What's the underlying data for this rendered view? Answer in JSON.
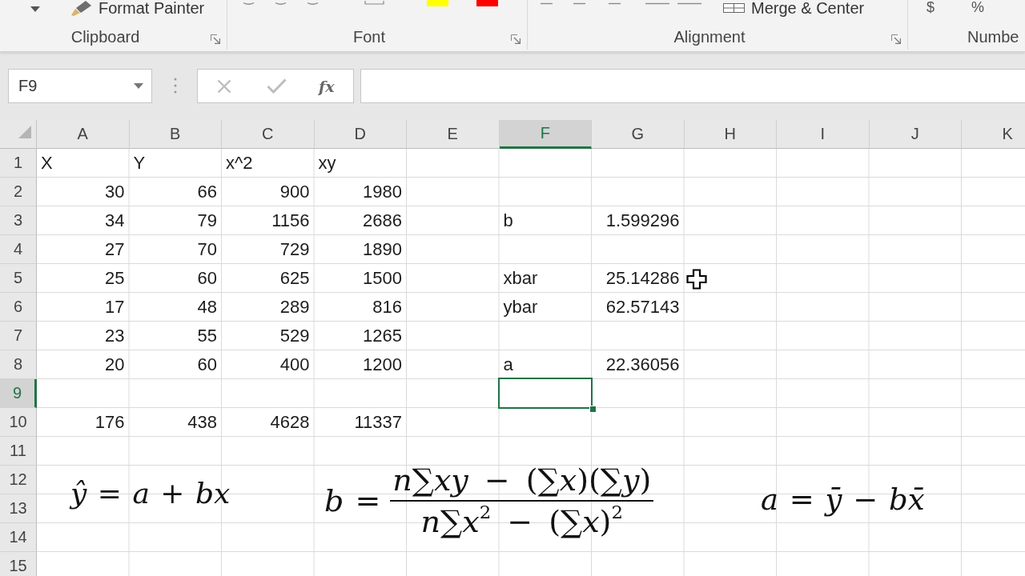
{
  "ribbon": {
    "groups": [
      {
        "kind": "clipboard",
        "label": "Clipboard",
        "launcher": true,
        "command": "Format Painter"
      },
      {
        "kind": "font",
        "label": "Font",
        "launcher": true,
        "swatches": [
          {
            "color": "#ffff00"
          },
          {
            "color": "#ff0000"
          }
        ]
      },
      {
        "kind": "alignment",
        "label": "Alignment",
        "launcher": true,
        "command": "Merge & Center"
      },
      {
        "kind": "number",
        "label": "Numbe",
        "symbols": [
          "$",
          "%"
        ]
      }
    ]
  },
  "formula_bar": {
    "name_box": "F9",
    "function_button": "fx"
  },
  "columns": [
    {
      "label": "A",
      "selected": false
    },
    {
      "label": "B",
      "selected": false
    },
    {
      "label": "C",
      "selected": false
    },
    {
      "label": "D",
      "selected": false
    },
    {
      "label": "E",
      "selected": false
    },
    {
      "label": "F",
      "selected": true
    },
    {
      "label": "G",
      "selected": false
    },
    {
      "label": "H",
      "selected": false
    },
    {
      "label": "I",
      "selected": false
    },
    {
      "label": "J",
      "selected": false
    },
    {
      "label": "K",
      "selected": false
    }
  ],
  "rows": [
    {
      "label": "1",
      "selected": false,
      "cells": [
        {
          "kind": "text",
          "value": "X"
        },
        {
          "kind": "text",
          "value": "Y"
        },
        {
          "kind": "text",
          "value": "x^2"
        },
        {
          "kind": "text",
          "value": "xy"
        }
      ]
    },
    {
      "label": "2",
      "selected": false,
      "cells": [
        {
          "kind": "number",
          "value": "30"
        },
        {
          "kind": "number",
          "value": "66"
        },
        {
          "kind": "number",
          "value": "900"
        },
        {
          "kind": "number",
          "value": "1980"
        }
      ]
    },
    {
      "label": "3",
      "selected": false,
      "cells": [
        {
          "kind": "number",
          "value": "34"
        },
        {
          "kind": "number",
          "value": "79"
        },
        {
          "kind": "number",
          "value": "1156"
        },
        {
          "kind": "number",
          "value": "2686"
        },
        null,
        {
          "kind": "text",
          "value": "b"
        },
        {
          "kind": "number",
          "value": "1.599296"
        }
      ]
    },
    {
      "label": "4",
      "selected": false,
      "cells": [
        {
          "kind": "number",
          "value": "27"
        },
        {
          "kind": "number",
          "value": "70"
        },
        {
          "kind": "number",
          "value": "729"
        },
        {
          "kind": "number",
          "value": "1890"
        }
      ]
    },
    {
      "label": "5",
      "selected": false,
      "cells": [
        {
          "kind": "number",
          "value": "25"
        },
        {
          "kind": "number",
          "value": "60"
        },
        {
          "kind": "number",
          "value": "625"
        },
        {
          "kind": "number",
          "value": "1500"
        },
        null,
        {
          "kind": "text",
          "value": "xbar"
        },
        {
          "kind": "number",
          "value": "25.14286"
        }
      ]
    },
    {
      "label": "6",
      "selected": false,
      "cells": [
        {
          "kind": "number",
          "value": "17"
        },
        {
          "kind": "number",
          "value": "48"
        },
        {
          "kind": "number",
          "value": "289"
        },
        {
          "kind": "number",
          "value": "816"
        },
        null,
        {
          "kind": "text",
          "value": "ybar"
        },
        {
          "kind": "number",
          "value": "62.57143"
        }
      ]
    },
    {
      "label": "7",
      "selected": false,
      "cells": [
        {
          "kind": "number",
          "value": "23"
        },
        {
          "kind": "number",
          "value": "55"
        },
        {
          "kind": "number",
          "value": "529"
        },
        {
          "kind": "number",
          "value": "1265"
        }
      ]
    },
    {
      "label": "8",
      "selected": false,
      "cells": [
        {
          "kind": "number",
          "value": "20"
        },
        {
          "kind": "number",
          "value": "60"
        },
        {
          "kind": "number",
          "value": "400"
        },
        {
          "kind": "number",
          "value": "1200"
        },
        null,
        {
          "kind": "text",
          "value": "a"
        },
        {
          "kind": "number",
          "value": "22.36056"
        }
      ]
    },
    {
      "label": "9",
      "selected": true
    },
    {
      "label": "10",
      "selected": false,
      "cells": [
        {
          "kind": "number",
          "value": "176"
        },
        {
          "kind": "number",
          "value": "438"
        },
        {
          "kind": "number",
          "value": "4628"
        },
        {
          "kind": "number",
          "value": "11337"
        }
      ]
    },
    {
      "label": "11",
      "selected": false
    },
    {
      "label": "12",
      "selected": false
    },
    {
      "label": "13",
      "selected": false
    },
    {
      "label": "14",
      "selected": false
    },
    {
      "label": "15",
      "selected": false
    }
  ],
  "equations": [
    {
      "kind": "inline",
      "text": "*ŷ* = *a* + *bx*"
    },
    {
      "kind": "fraction",
      "lhs": "*b* =",
      "numerator": "*n*∑*xy* − (∑*x*)(∑*y*)",
      "denominator": "*n*∑*x*$^{2}$ − (∑*x*)$^{2}$"
    },
    {
      "kind": "inline",
      "text": "*a* = *ȳ* − *bx̄*"
    }
  ]
}
